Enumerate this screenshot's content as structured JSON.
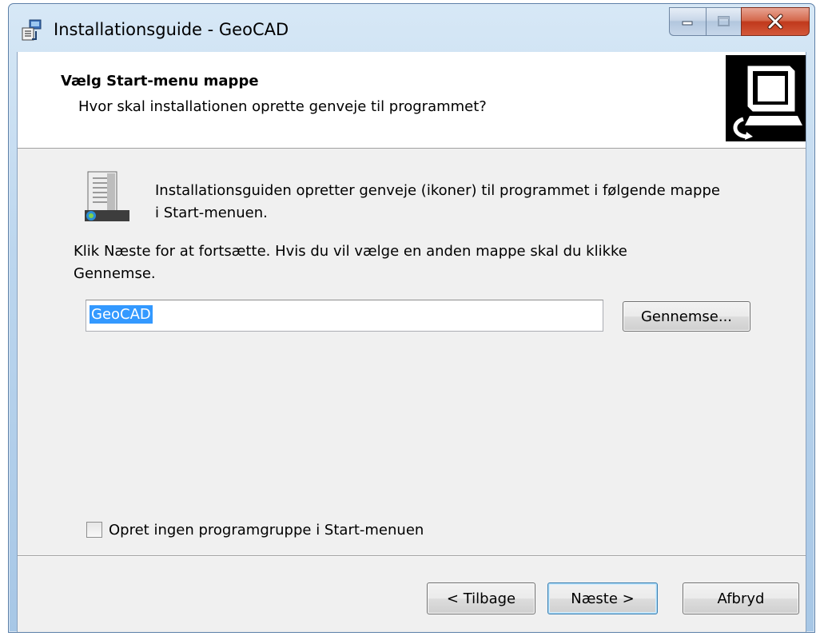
{
  "window": {
    "title": "Installationsguide - GeoCAD"
  },
  "header": {
    "title": "Vælg Start-menu mappe",
    "subtitle": "Hvor skal installationen oprette genveje til programmet?"
  },
  "body": {
    "intro_line1": "Installationsguiden opretter genveje (ikoner) til programmet i følgende mappe",
    "intro_line2": "i Start-menuen.",
    "instruction_line1": "Klik Næste for at fortsætte. Hvis du vil vælge en anden mappe skal du klikke",
    "instruction_line2": "Gennemse.",
    "folder_value": "GeoCAD",
    "browse_label": "Gennemse...",
    "no_group_label": "Opret ingen programgruppe i Start-menuen",
    "no_group_checked": false
  },
  "footer": {
    "back_label": "< Tilbage",
    "next_label": "Næste >",
    "cancel_label": "Afbryd"
  },
  "icons": {
    "app": "installer-icon",
    "header": "computer-install-icon",
    "body": "start-menu-folder-icon",
    "minimize": "minimize-icon",
    "maximize": "maximize-icon",
    "close": "close-icon"
  },
  "colors": {
    "titlebar": "#bcd6ee",
    "close_button": "#c0391c",
    "selection": "#3399ff",
    "dialog_bg": "#f0f0f0"
  }
}
